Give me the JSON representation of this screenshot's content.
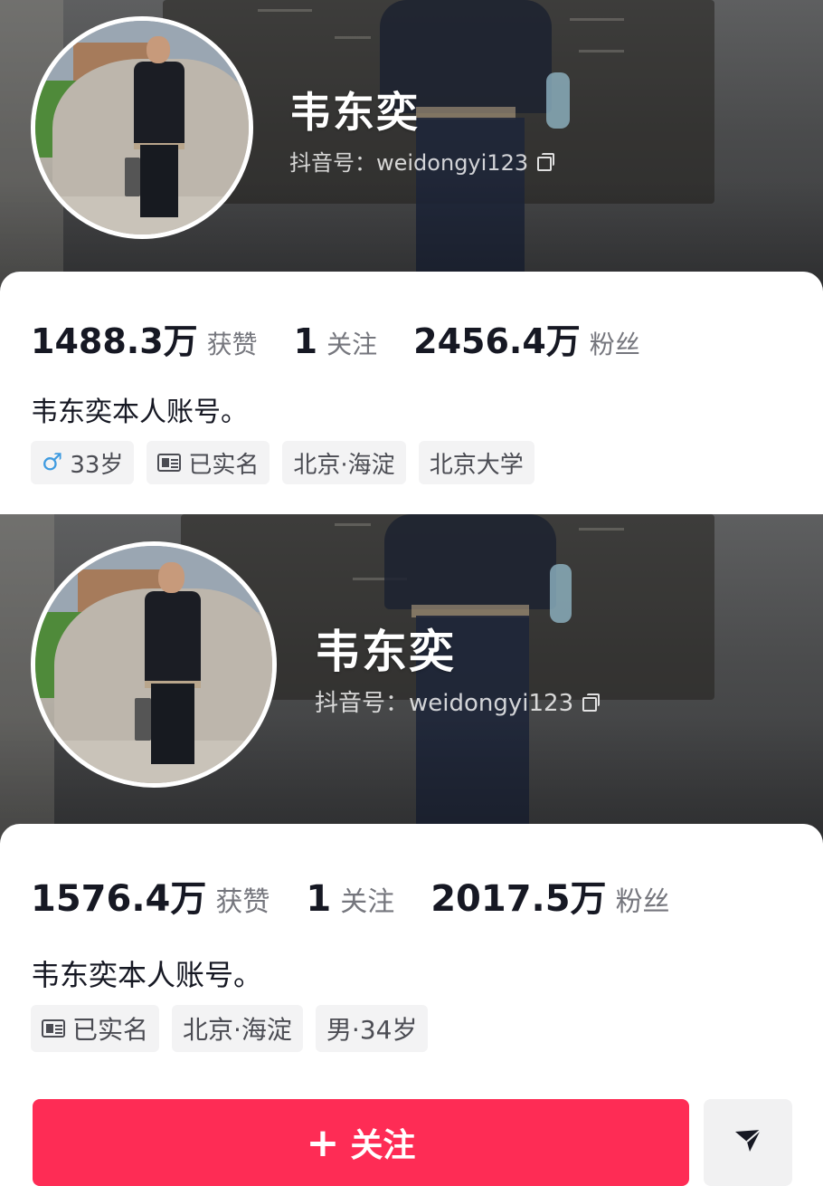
{
  "profiles": [
    {
      "name": "韦东奕",
      "douyin_id": "抖音号：weidongyi123",
      "stats": [
        {
          "value": "1488.3万",
          "label": "获赞"
        },
        {
          "value": "1",
          "label": "关注"
        },
        {
          "value": "2456.4万",
          "label": "粉丝"
        }
      ],
      "bio": "韦东奕本人账号。",
      "tags": {
        "gender_age": "33岁",
        "verified": "已实名",
        "location": "北京·海淀",
        "school": "北京大学"
      }
    },
    {
      "name": "韦东奕",
      "douyin_id": "抖音号：weidongyi123",
      "stats": [
        {
          "value": "1576.4万",
          "label": "获赞"
        },
        {
          "value": "1",
          "label": "关注"
        },
        {
          "value": "2017.5万",
          "label": "粉丝"
        }
      ],
      "bio": "韦东奕本人账号。",
      "tags": {
        "verified": "已实名",
        "location": "北京·海淀",
        "gender_age": "男·34岁"
      }
    }
  ],
  "actions": {
    "follow_label": "关注",
    "follow_icon": "plus-icon",
    "message_icon": "send-icon"
  },
  "colors": {
    "accent": "#fe2c55",
    "male": "#3f9be0"
  }
}
